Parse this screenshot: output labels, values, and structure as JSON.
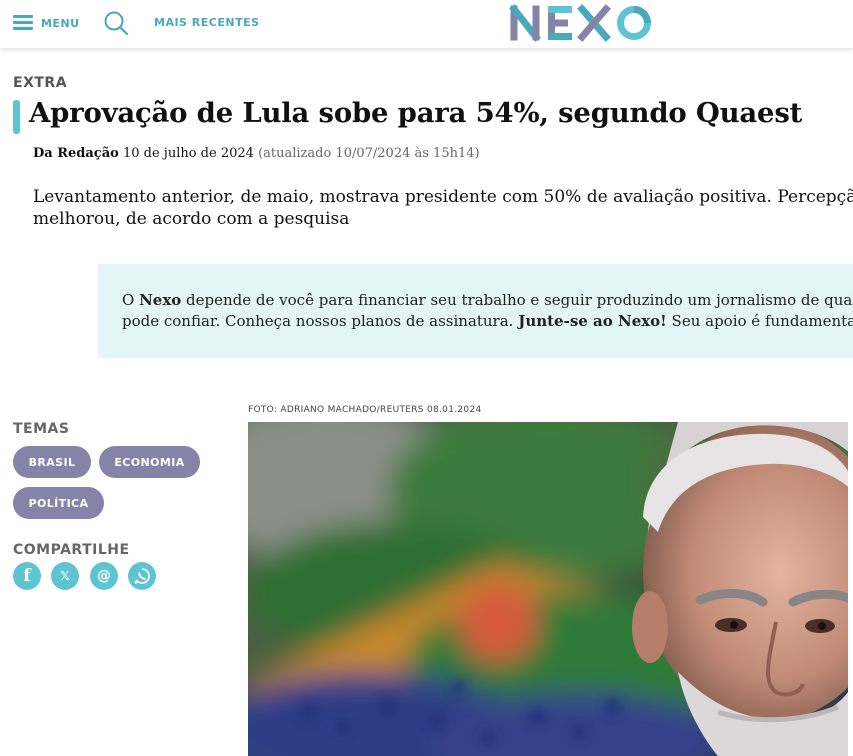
{
  "header": {
    "menu_label": "MENU",
    "recent_label": "MAIS RECENTES",
    "logo": {
      "text": "NEXO",
      "colors": [
        "#8683a8",
        "#4aa8bc",
        "#5ec5d0",
        "#7b78a4"
      ]
    },
    "icons": [
      "menu-icon",
      "search-icon"
    ]
  },
  "article": {
    "kicker": "EXTRA",
    "headline": "Aprovação de Lula sobe para 54%, segundo Quaest",
    "author": "Da Redação",
    "date": "10 de julho de 2024",
    "updated": "(atualizado 10/07/2024 às 15h14)",
    "lede": "Levantamento anterior, de maio, mostrava presidente com 50% de avaliação positiva. Percepção sobre a economia\nmelhorou, de acordo com a pesquisa"
  },
  "promo": {
    "t1": "O ",
    "nexo": "Nexo",
    "t2": " depende de você para financiar seu trabalho e seguir produzindo um jornalismo de qualidade, no qual se",
    "t3": "pode confiar. Conheça nossos planos de assinatura. ",
    "join": "Junte-se ao Nexo!",
    "t4": " Seu apoio é fundamental."
  },
  "sidebar": {
    "topics_label": "TEMAS",
    "tags": [
      "BRASIL",
      "ECONOMIA",
      "POLÍTICA"
    ],
    "share_label": "COMPARTILHE",
    "share_icons": [
      "facebook-icon",
      "x-icon",
      "email-icon",
      "whatsapp-icon"
    ]
  },
  "photo": {
    "credit": "FOTO: ADRIANO MACHADO/REUTERS 08.01.2024"
  },
  "colors": {
    "accent": "#5ec5d0",
    "tag": "#8683a8",
    "promo_bg": "#e4f5f8",
    "link": "#4aa8bc"
  }
}
